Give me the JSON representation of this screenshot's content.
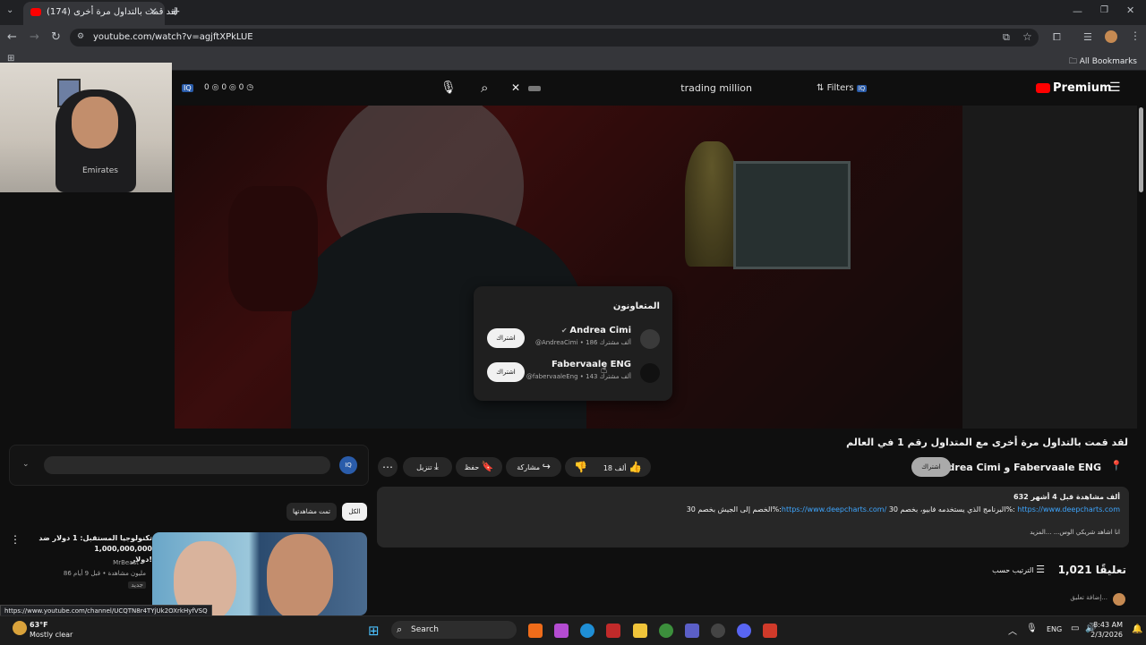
{
  "browser": {
    "tab_title": "(174) لقد قمت بالتداول مرة أخرى",
    "url": "youtube.com/watch?v=agjftXPkLUE",
    "bookmarks_label": "All Bookmarks",
    "status_url": "https://www.youtube.com/channel/UCQTN8r4TYjUk2OXrkHyfVSQ"
  },
  "overlay_counters": [
    "0",
    "0",
    "0"
  ],
  "yt_header": {
    "search_query": "trading million",
    "filters_label": "Filters",
    "premium_label": "Premium"
  },
  "collaborators_popup": {
    "title": "المتعاونون",
    "items": [
      {
        "name": "Andrea Cimi",
        "meta": "@AndreaCimi • 186 ألف مشترك",
        "subscribe": "اشتراك"
      },
      {
        "name": "Fabervaale ENG",
        "meta": "@fabervaaleEng • 143 ألف مشترك",
        "subscribe": "اشتراك"
      }
    ]
  },
  "video": {
    "title": "لقد قمت بالتداول مرة أخرى مع المتداول رقم 1 في العالم",
    "channel": "Andrea Cimi و Fabervaale ENG",
    "subscribe_label": "اشتراك",
    "likes": "18 ألف",
    "share_label": "مشاركة",
    "save_label": "حفظ",
    "download_label": "تنزيل"
  },
  "description": {
    "stats": "632 ألف مشاهدة  قبل 4 أشهر",
    "link1": "https://www.deepcharts.com",
    "line1_text": "البرنامج الذي يستخدمه فابيو، بخصم 30%:",
    "link2": "https://www.deepcharts.com/",
    "line1_tail": "الخصم إلى الجيش بخصم 30%:",
    "line2": "انا اشاهد شريكي الوس... ...المزيد"
  },
  "comments": {
    "count": "1,021 تعليقًا",
    "sort_label": "الترتيب حسب",
    "add_placeholder": "إضافة تعليق..."
  },
  "filter_chips": [
    "الكل",
    "تمت مشاهدتها"
  ],
  "recommendation": {
    "title_line1": "تكنولوجيا المستقبل: 1 دولار ضد",
    "title_line2": "1,000,000,000",
    "title_line3": "دولار!",
    "channel": "MrBeast",
    "meta": "86 مليون مشاهدة • قبل 9 أيام",
    "badge": "جديد"
  },
  "taskbar": {
    "temp": "63°F",
    "weather": "Mostly clear",
    "search_label": "Search",
    "lang": "ENG",
    "time": "8:43 AM",
    "date": "2/3/2026"
  }
}
